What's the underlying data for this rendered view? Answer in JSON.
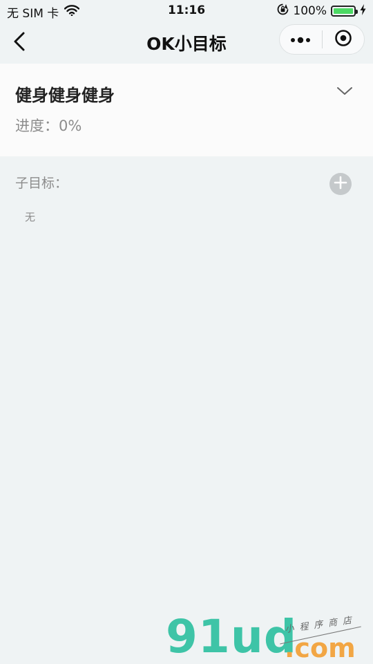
{
  "status_bar": {
    "carrier": "无 SIM 卡",
    "time": "11:16",
    "battery": "100%",
    "battery_level": 1.0,
    "battery_color": "#4cd964"
  },
  "nav": {
    "title": "OK小目标",
    "back_icon": "chevron-left-icon",
    "menu_icon": "more-dots-icon",
    "close_icon": "target-circle-icon"
  },
  "goal": {
    "title": "健身健身健身",
    "progress": "进度：0%",
    "progress_value": 0,
    "toggle_icon": "chevron-down-icon"
  },
  "subgoals": {
    "label": "子目标：",
    "add_icon": "plus-circle-icon",
    "empty_text": "无"
  },
  "watermark": {
    "logo": "91ud",
    "domain": ".com",
    "tagline": "小程序商店"
  },
  "colors": {
    "background": "#eff3f4",
    "card": "#fbfbfb",
    "muted_text": "#8c8c8c",
    "add_button": "#c5c9cb",
    "watermark_green": "#3ec4a7",
    "watermark_orange": "#f2a644"
  }
}
